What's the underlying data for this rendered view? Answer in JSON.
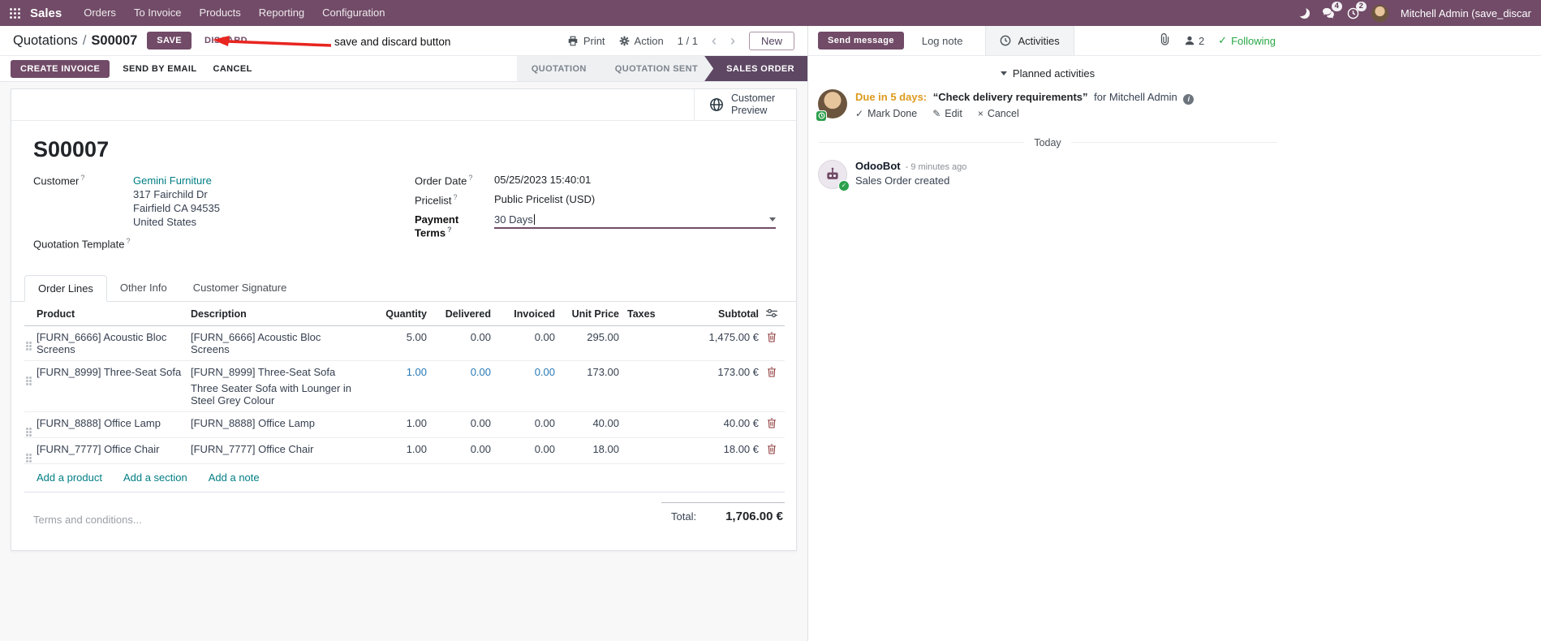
{
  "colors": {
    "primary": "#714B67",
    "link": "#017e84",
    "edited_value": "#2779b5",
    "status_active": "#5d4763",
    "warning": "#dd9a1d",
    "success": "#28a745",
    "annotation_red": "#e8251f"
  },
  "icons": {
    "check": "✓",
    "pencil": "✎",
    "cancel_x": "×",
    "prev": "‹",
    "next": "›",
    "info": "i",
    "question": "?"
  },
  "nav": {
    "app": "Sales",
    "menus": [
      "Orders",
      "To Invoice",
      "Products",
      "Reporting",
      "Configuration"
    ],
    "messages_badge": "4",
    "activities_badge": "2",
    "user_name": "Mitchell Admin (save_discar"
  },
  "control": {
    "breadcrumb_parent": "Quotations",
    "breadcrumb_sep": "/",
    "breadcrumb_current": "S00007",
    "save": "SAVE",
    "discard": "DISCARD",
    "annotation": "save and discard button",
    "print": "Print",
    "action": "Action",
    "pager": "1 / 1",
    "new": "New"
  },
  "statusbar": {
    "create_invoice": "CREATE INVOICE",
    "send_by_email": "SEND BY EMAIL",
    "cancel": "CANCEL",
    "steps": [
      {
        "label": "QUOTATION"
      },
      {
        "label": "QUOTATION SENT"
      },
      {
        "label": "SALES ORDER"
      }
    ]
  },
  "form": {
    "preview_label": "Customer Preview",
    "title": "S00007",
    "customer_label": "Customer",
    "customer_name": "Gemini Furniture",
    "address_line1": "317 Fairchild Dr",
    "address_line2": "Fairfield CA 94535",
    "address_line3": "United States",
    "quotation_template_label": "Quotation Template",
    "order_date_label": "Order Date",
    "order_date_value": "05/25/2023 15:40:01",
    "pricelist_label": "Pricelist",
    "pricelist_value": "Public Pricelist (USD)",
    "payment_terms_label": "Payment Terms",
    "payment_terms_value": "30 Days",
    "tabs": [
      "Order Lines",
      "Other Info",
      "Customer Signature"
    ],
    "table": {
      "headers": [
        "Product",
        "Description",
        "Quantity",
        "Delivered",
        "Invoiced",
        "Unit Price",
        "Taxes",
        "Subtotal"
      ],
      "rows": [
        {
          "product": "[FURN_6666] Acoustic Bloc Screens",
          "desc": "[FURN_6666] Acoustic Bloc Screens",
          "desc2": "",
          "qty": "5.00",
          "delivered": "0.00",
          "invoiced": "0.00",
          "price": "295.00",
          "taxes": "",
          "subtotal": "1,475.00 €"
        },
        {
          "product": "[FURN_8999] Three-Seat Sofa",
          "desc": "[FURN_8999] Three-Seat Sofa",
          "desc2": "Three Seater Sofa with Lounger in Steel Grey Colour",
          "qty": "1.00",
          "delivered": "0.00",
          "invoiced": "0.00",
          "price": "173.00",
          "taxes": "",
          "subtotal": "173.00 €"
        },
        {
          "product": "[FURN_8888] Office Lamp",
          "desc": "[FURN_8888] Office Lamp",
          "desc2": "",
          "qty": "1.00",
          "delivered": "0.00",
          "invoiced": "0.00",
          "price": "40.00",
          "taxes": "",
          "subtotal": "40.00 €"
        },
        {
          "product": "[FURN_7777] Office Chair",
          "desc": "[FURN_7777] Office Chair",
          "desc2": "",
          "qty": "1.00",
          "delivered": "0.00",
          "invoiced": "0.00",
          "price": "18.00",
          "taxes": "",
          "subtotal": "18.00 €"
        }
      ],
      "add_product": "Add a product",
      "add_section": "Add a section",
      "add_note": "Add a note"
    },
    "terms_placeholder": "Terms and conditions...",
    "total_label": "Total:",
    "total_value": "1,706.00 €"
  },
  "chatter": {
    "send_message": "Send message",
    "log_note": "Log note",
    "activities": "Activities",
    "followers_count": "2",
    "following": "Following",
    "planned_header": "Planned activities",
    "activity_due": "Due in 5 days:",
    "activity_summary": "“Check delivery requirements”",
    "activity_for": "for Mitchell Admin",
    "mark_done": "Mark Done",
    "edit": "Edit",
    "cancel": "Cancel",
    "date_divider": "Today",
    "msg_author": "OdooBot",
    "msg_time": "- 9 minutes ago",
    "msg_body": "Sales Order created"
  }
}
